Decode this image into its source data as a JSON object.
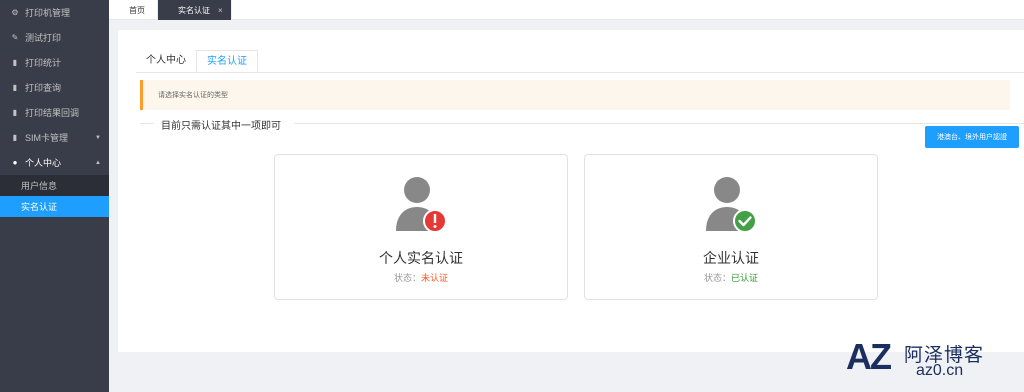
{
  "sidebar": {
    "items": [
      {
        "label": "打印机管理",
        "icon": "gears-icon"
      },
      {
        "label": "测试打印",
        "icon": "edit-icon"
      },
      {
        "label": "打印统计",
        "icon": "chat-icon"
      },
      {
        "label": "打印查询",
        "icon": "chat-icon"
      },
      {
        "label": "打印结果回调",
        "icon": "chat-icon"
      },
      {
        "label": "SIM卡管理",
        "icon": "chat-icon"
      },
      {
        "label": "个人中心",
        "icon": "user-icon"
      }
    ],
    "sub_items": [
      {
        "label": "用户信息"
      },
      {
        "label": "实名认证"
      }
    ]
  },
  "tabs": {
    "home": "首页",
    "current": "实名认证",
    "close": "×"
  },
  "subtabs": {
    "personal_center": "个人中心",
    "real_name": "实名认证"
  },
  "alert": {
    "text": "请选择实名认证的类型"
  },
  "legend": "目前只需认证其中一项即可",
  "overseas_button": "港澳台、境外用户認證",
  "personal": {
    "title": "个人实名认证",
    "status_label": "状态：",
    "status_value": "未认证"
  },
  "enterprise": {
    "title": "企业认证",
    "status_label": "状态：",
    "status_value": "已认证"
  },
  "watermark": {
    "logo": "AZ",
    "name": "阿泽博客",
    "url": "az0.cn"
  },
  "colors": {
    "sidebar_bg": "#393d49",
    "accent": "#1e9fff",
    "warning": "#ff9b2b",
    "error": "#ff5722",
    "success": "#2f9c2f"
  }
}
